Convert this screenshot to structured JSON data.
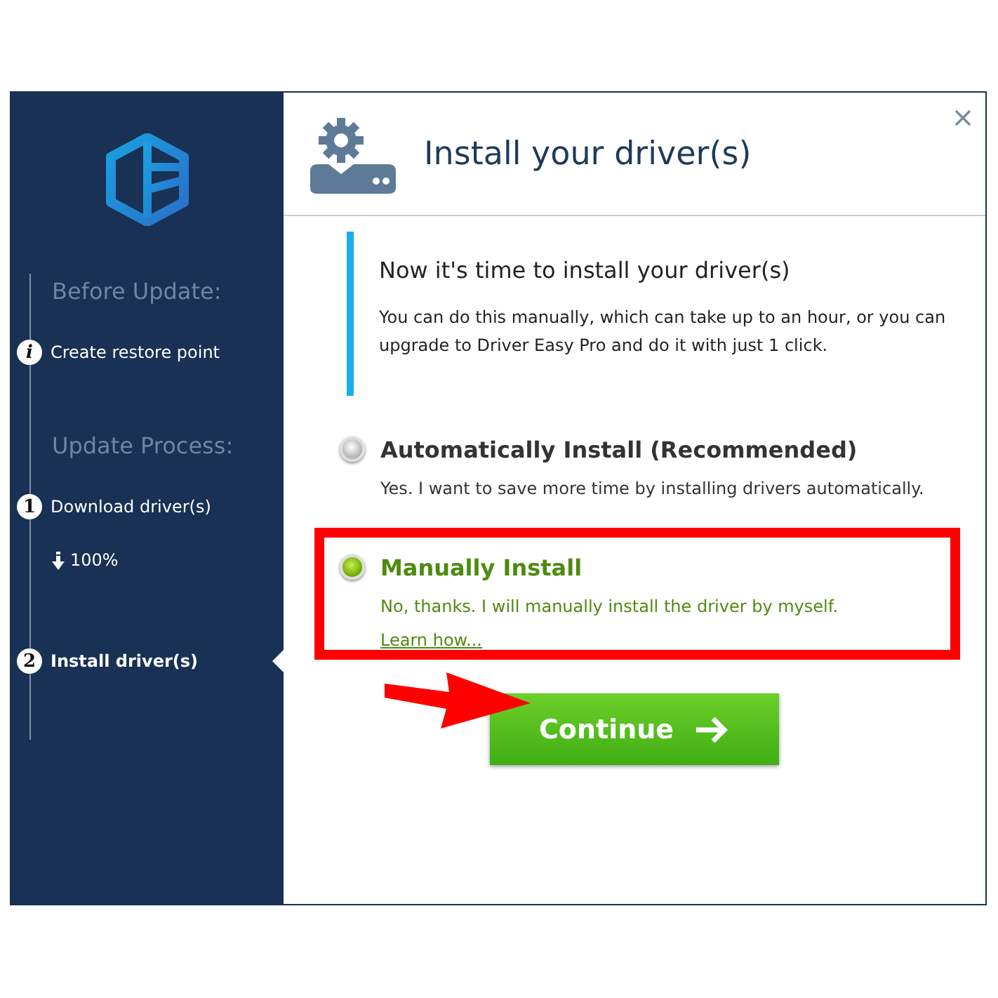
{
  "sidebar": {
    "steps": [
      {
        "kind": "heading",
        "label": "Before Update:"
      },
      {
        "kind": "step",
        "badge": "i",
        "label": "Create restore point",
        "selected": false
      },
      {
        "kind": "heading",
        "label": "Update Process:"
      },
      {
        "kind": "step",
        "badge": "1",
        "label": "Download driver(s)",
        "selected": false
      },
      {
        "kind": "progress",
        "label": "100%"
      },
      {
        "kind": "step",
        "badge": "2",
        "label": "Install driver(s)",
        "selected": true
      }
    ]
  },
  "header": {
    "title": "Install your driver(s)"
  },
  "notice": {
    "heading": "Now it's time to install your driver(s)",
    "text": "You can do this manually, which can take up to an hour, or you can upgrade to Driver Easy Pro and do it with just 1 click."
  },
  "options": [
    {
      "title": "Automatically Install (Recommended)",
      "description": "Yes. I want to save more time by installing drivers automatically.",
      "selected": false,
      "highlighted": false
    },
    {
      "title": "Manually Install",
      "description": "No, thanks. I will manually install the driver by myself.",
      "link": "Learn how...",
      "selected": true,
      "highlighted": true
    }
  ],
  "continue_button": {
    "label": "Continue",
    "annotated": true
  }
}
